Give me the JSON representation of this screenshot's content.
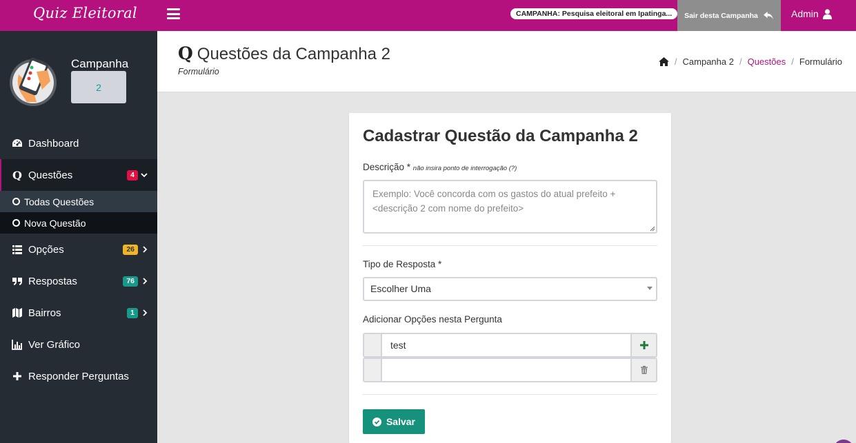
{
  "app": {
    "logo": "Quiz Eleitoral"
  },
  "topbar": {
    "campaign_pill": "CAMPANHA: Pesquisa eleitoral em Ipatinga...",
    "leave_label": "Sair desta Campanha",
    "admin_label": "Admin"
  },
  "sidebar": {
    "campaign_label": "Campanha",
    "campaign_number": "2",
    "items": [
      {
        "label": "Dashboard",
        "icon": "dashboard-icon"
      },
      {
        "label": "Questões",
        "icon": "q-icon",
        "badge": "4",
        "badge_color": "#dd1144"
      },
      {
        "label": "Opções",
        "icon": "list-icon",
        "badge": "26",
        "badge_color": "#f0b429"
      },
      {
        "label": "Respostas",
        "icon": "quote-icon",
        "badge": "76",
        "badge_color": "#179a8a"
      },
      {
        "label": "Bairros",
        "icon": "map-icon",
        "badge": "1",
        "badge_color": "#179a8a"
      },
      {
        "label": "Ver Gráfico",
        "icon": "bar-chart-icon"
      },
      {
        "label": "Responder Perguntas",
        "icon": "plus-icon"
      }
    ],
    "subitems": [
      {
        "label": "Todas Questões"
      },
      {
        "label": "Nova Questão"
      }
    ]
  },
  "header": {
    "title": "Questões da Campanha 2",
    "title_icon_letter": "Q",
    "subtitle": "Formulário",
    "breadcrumb": [
      "Campanha 2",
      "Questões",
      "Formulário"
    ]
  },
  "form": {
    "heading": "Cadastrar Questão da Campanha 2",
    "description_label": "Descrição *",
    "description_hint": "não insira ponto de interrogação (?)",
    "description_placeholder": "Exemplo: Você concorda com os gastos do atual prefeito + <descrição 2 com nome do prefeito>",
    "type_label": "Tipo de Resposta *",
    "type_value": "Escolher Uma",
    "options_label": "Adicionar Opções nesta Pergunta",
    "options": [
      "test",
      ""
    ],
    "save_label": "Salvar"
  },
  "colors": {
    "brand": "#b5117e",
    "sidebar": "#252c34",
    "save": "#15917c"
  }
}
